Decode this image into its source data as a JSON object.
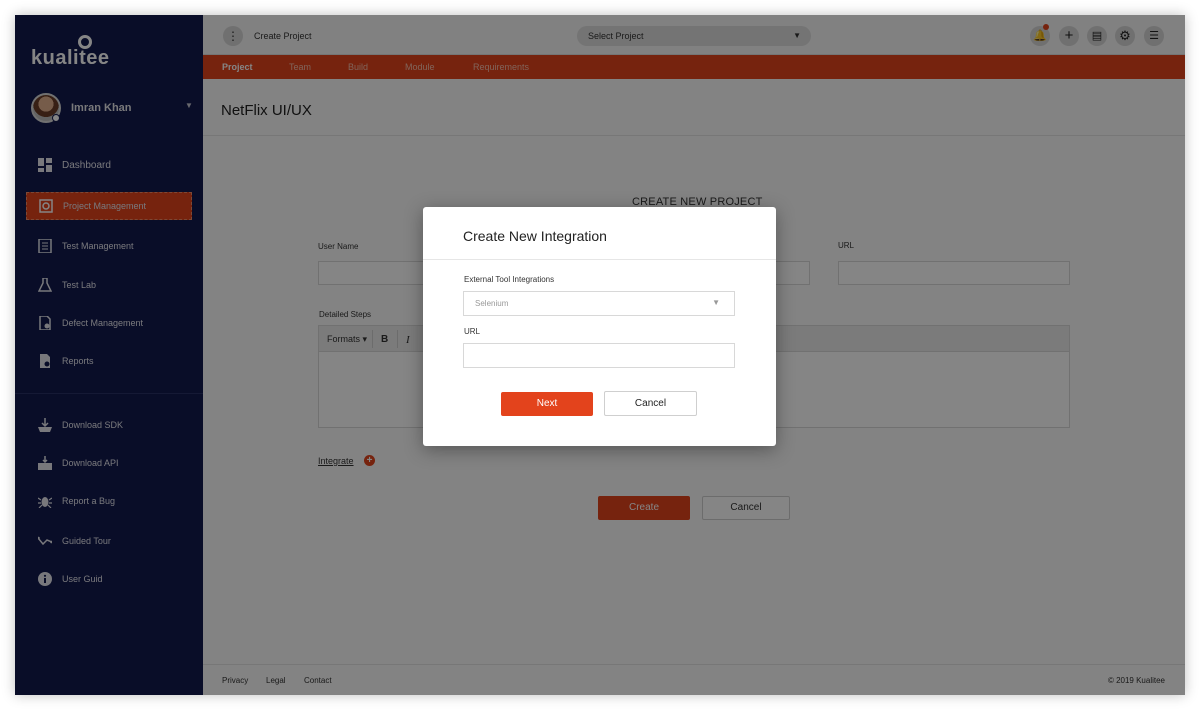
{
  "brand": {
    "logo_text": "kualitee"
  },
  "user": {
    "name": "Imran Khan"
  },
  "sidebar": {
    "items": [
      {
        "label": "Dashboard",
        "icon": "dashboard-icon"
      },
      {
        "label": "Project Management",
        "icon": "project-management-icon",
        "active": true
      },
      {
        "label": "Test Management",
        "icon": "test-management-icon"
      },
      {
        "label": "Test Lab",
        "icon": "flask-icon"
      },
      {
        "label": "Defect Management",
        "icon": "defect-icon"
      },
      {
        "label": "Reports",
        "icon": "reports-icon"
      }
    ],
    "secondary": [
      {
        "label": "Download SDK",
        "icon": "download-sdk-icon"
      },
      {
        "label": "Download API",
        "icon": "download-api-icon"
      },
      {
        "label": "Report a Bug",
        "icon": "bug-icon"
      },
      {
        "label": "Guided Tour",
        "icon": "guided-tour-icon"
      },
      {
        "label": "User Guid",
        "icon": "info-icon"
      }
    ]
  },
  "topbar": {
    "breadcrumb": "Create Project",
    "project_select": "Select Project",
    "buttons": [
      "bell-icon",
      "plus-icon",
      "document-icon",
      "gear-icon",
      "list-icon"
    ]
  },
  "tabs": [
    {
      "label": "Project",
      "active": true
    },
    {
      "label": "Team"
    },
    {
      "label": "Build"
    },
    {
      "label": "Module"
    },
    {
      "label": "Requirements"
    }
  ],
  "page": {
    "title": "NetFlix UI/UX",
    "form_heading": "CREATE NEW PROJECT",
    "user_name_label": "User Name",
    "url_label": "URL",
    "detailed_steps_label": "Detailed Steps",
    "editor_formats": "Formats",
    "editor_bold": "B",
    "editor_italic": "I",
    "integrate_link": "Integrate",
    "create_button": "Create",
    "cancel_button": "Cancel"
  },
  "footer": {
    "links": [
      "Privacy",
      "Legal",
      "Contact"
    ],
    "copyright": "© 2019 Kualitee"
  },
  "modal": {
    "title": "Create New Integration",
    "tool_label": "External Tool Integrations",
    "tool_value": "Selenium",
    "url_label": "URL",
    "url_value": "",
    "next_button": "Next",
    "cancel_button": "Cancel"
  },
  "colors": {
    "accent": "#e3431c",
    "sidebar": "#131a4d"
  }
}
